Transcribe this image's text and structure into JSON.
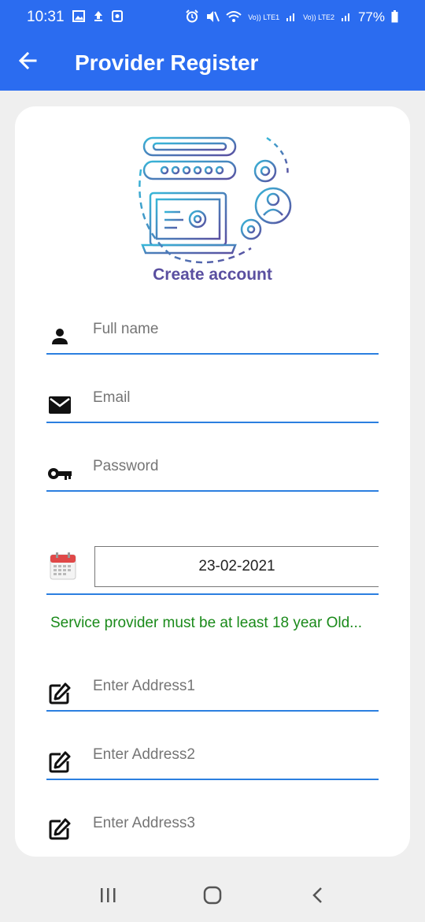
{
  "status_bar": {
    "time": "10:31",
    "battery": "77%",
    "sim1": "Vo)) LTE1",
    "sim2": "Vo)) LTE2"
  },
  "app_bar": {
    "title": "Provider Register",
    "back_icon": "arrow-left-icon"
  },
  "illustration": {
    "caption": "Create account"
  },
  "form": {
    "full_name": {
      "placeholder": "Full name",
      "icon": "person-icon"
    },
    "email": {
      "placeholder": "Email",
      "icon": "mail-icon"
    },
    "password": {
      "placeholder": "Password",
      "icon": "key-icon"
    },
    "date": {
      "value": "23-02-2021",
      "icon": "calendar-icon"
    },
    "age_note": "Service provider must be at least 18 year Old...",
    "address1": {
      "placeholder": "Enter Address1",
      "icon": "edit-icon"
    },
    "address2": {
      "placeholder": "Enter Address2",
      "icon": "edit-icon"
    },
    "address3": {
      "placeholder": "Enter Address3",
      "icon": "edit-icon"
    }
  },
  "colors": {
    "primary": "#2b6cf0",
    "underline": "#2b7fe0",
    "note": "#1a8a1a",
    "caption": "#5a4fa0"
  },
  "nav": {
    "recents_icon": "recents-icon",
    "home_icon": "home-icon",
    "back_icon": "back-chevron-icon"
  }
}
